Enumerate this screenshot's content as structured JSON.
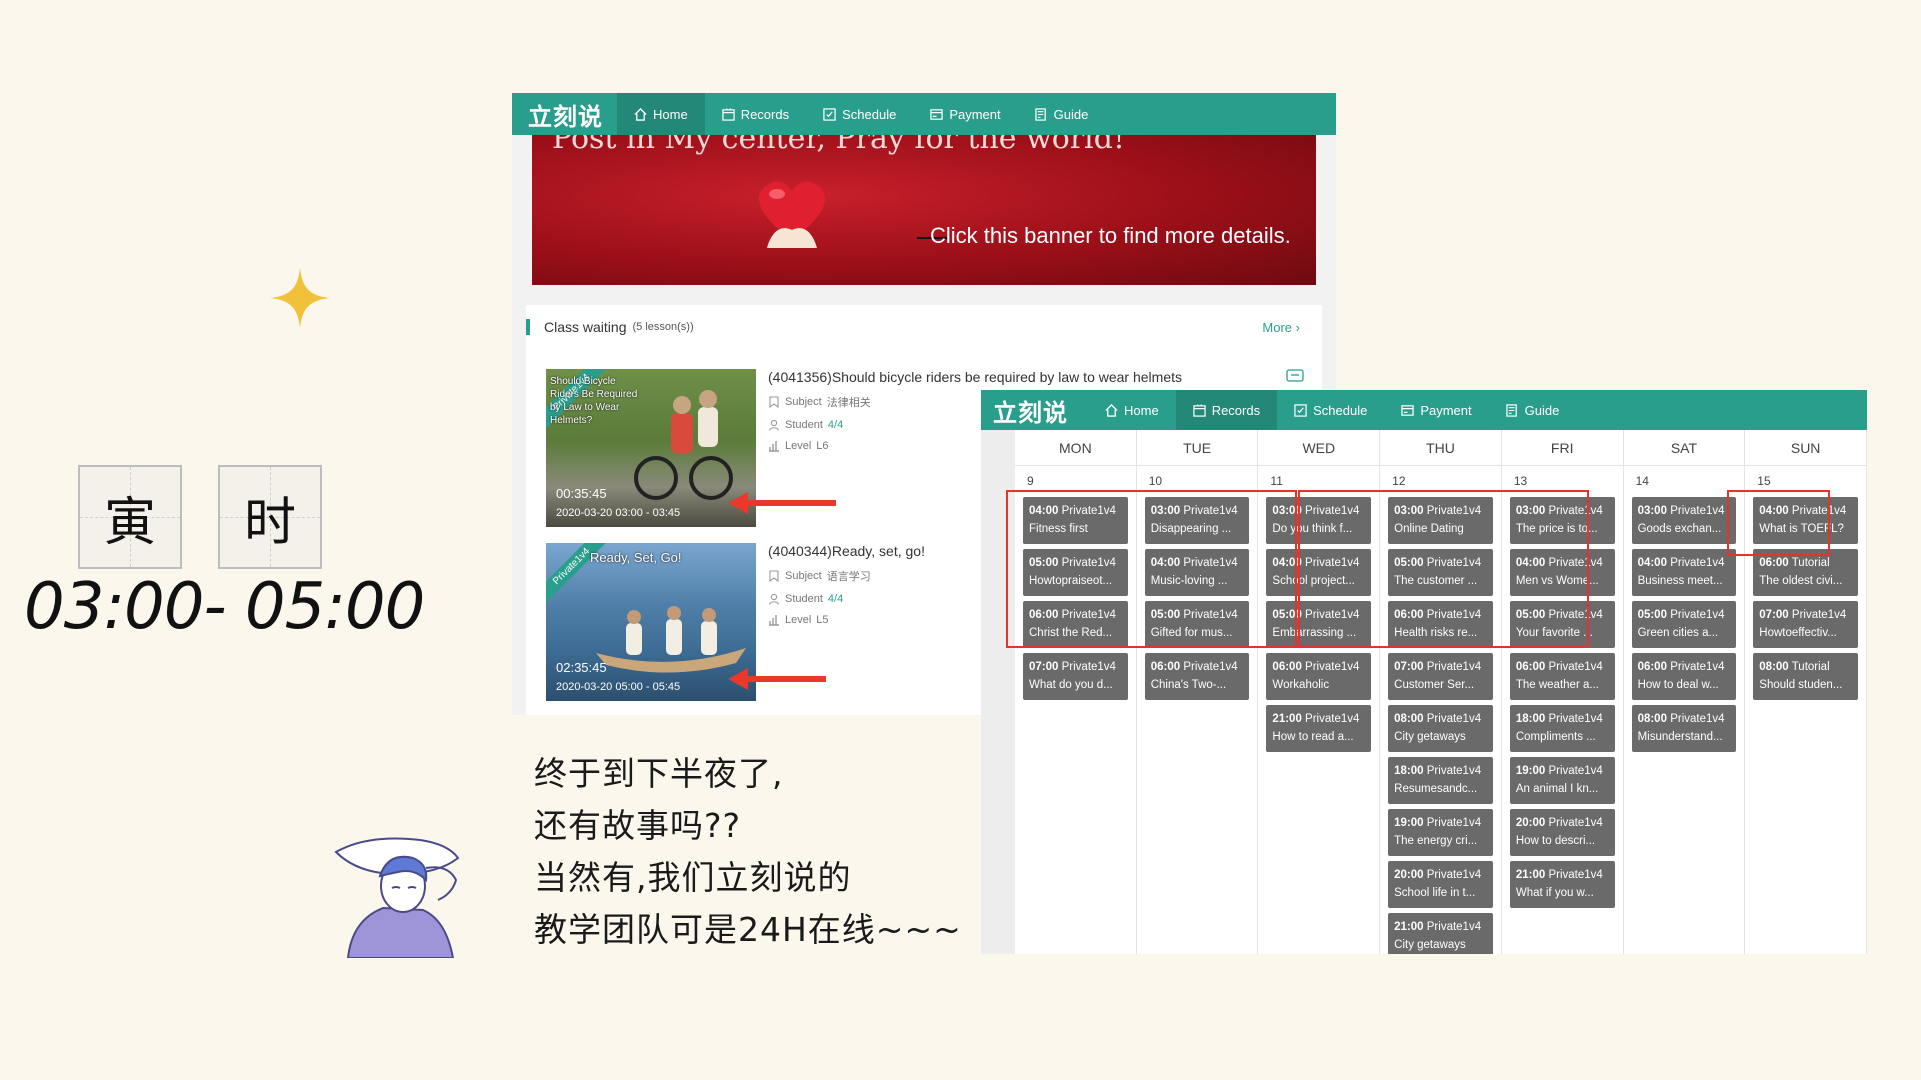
{
  "badge": {
    "chars": [
      "寅",
      "时"
    ],
    "time_range": "03:00- 05:00"
  },
  "caption": {
    "lines": [
      "终于到下半夜了,",
      "还有故事吗??",
      "当然有,我们立刻说的",
      "教学团队可是24H在线~~~"
    ]
  },
  "colors": {
    "brand": "#2a9e8c",
    "highlight": "#e5322b",
    "event_bg": "#6a6a6a"
  },
  "nav1": {
    "logo": "立刻说",
    "items": [
      {
        "label": "Home",
        "icon": "home-icon"
      },
      {
        "label": "Records",
        "icon": "records-icon"
      },
      {
        "label": "Schedule",
        "icon": "schedule-icon"
      },
      {
        "label": "Payment",
        "icon": "payment-icon"
      },
      {
        "label": "Guide",
        "icon": "guide-icon"
      }
    ]
  },
  "banner": {
    "slogan": "Post in My center, Pray for the world!",
    "cta": "Click this banner to find more details."
  },
  "class_waiting": {
    "title": "Class waiting",
    "count": "(5 lesson(s))",
    "more": "More",
    "lessons": [
      {
        "title": "(4041356)Should bicycle riders be required by law to wear helmets",
        "thumb_text": "Should Bicycle Riders Be Required by Law to Wear Helmets?",
        "ribbon": "Private1v4",
        "duration": "00:35:45",
        "date": "2020-03-20 03:00 - 03:45",
        "subject_label": "Subject",
        "subject": "法律相关",
        "student_label": "Student",
        "student": "4/4",
        "level_label": "Level",
        "level": "L6"
      },
      {
        "title": "(4040344)Ready, set, go!",
        "thumb_text": "Ready, Set, Go!",
        "ribbon": "Private1v4",
        "duration": "02:35:45",
        "date": "2020-03-20 05:00 - 05:45",
        "subject_label": "Subject",
        "subject": "语言学习",
        "student_label": "Student",
        "student": "4/4",
        "level_label": "Level",
        "level": "L5"
      }
    ]
  },
  "nav2": {
    "logo": "立刻说",
    "items": [
      {
        "label": "Home",
        "icon": "home-icon"
      },
      {
        "label": "Records",
        "icon": "records-icon"
      },
      {
        "label": "Schedule",
        "icon": "schedule-icon"
      },
      {
        "label": "Payment",
        "icon": "payment-icon"
      },
      {
        "label": "Guide",
        "icon": "guide-icon"
      }
    ]
  },
  "calendar": {
    "days": [
      {
        "name": "MON",
        "num": "9",
        "events": [
          {
            "time": "04:00",
            "type": "Private1v4",
            "title": "Fitness first"
          },
          {
            "time": "05:00",
            "type": "Private1v4",
            "title": "Howtopraiseot..."
          },
          {
            "time": "06:00",
            "type": "Private1v4",
            "title": "Christ the Red..."
          },
          {
            "time": "07:00",
            "type": "Private1v4",
            "title": "What do you d..."
          }
        ]
      },
      {
        "name": "TUE",
        "num": "10",
        "events": [
          {
            "time": "03:00",
            "type": "Private1v4",
            "title": "Disappearing ..."
          },
          {
            "time": "04:00",
            "type": "Private1v4",
            "title": "Music-loving ..."
          },
          {
            "time": "05:00",
            "type": "Private1v4",
            "title": "Gifted for mus..."
          },
          {
            "time": "06:00",
            "type": "Private1v4",
            "title": "China's Two-..."
          }
        ]
      },
      {
        "name": "WED",
        "num": "11",
        "events": [
          {
            "time": "03:00",
            "type": "Private1v4",
            "title": "Do you think f..."
          },
          {
            "time": "04:00",
            "type": "Private1v4",
            "title": "School project..."
          },
          {
            "time": "05:00",
            "type": "Private1v4",
            "title": "Embarrassing ..."
          },
          {
            "time": "06:00",
            "type": "Private1v4",
            "title": "Workaholic"
          },
          {
            "time": "21:00",
            "type": "Private1v4",
            "title": "How to read a..."
          }
        ]
      },
      {
        "name": "THU",
        "num": "12",
        "events": [
          {
            "time": "03:00",
            "type": "Private1v4",
            "title": "Online Dating"
          },
          {
            "time": "05:00",
            "type": "Private1v4",
            "title": "The customer ..."
          },
          {
            "time": "06:00",
            "type": "Private1v4",
            "title": "Health risks re..."
          },
          {
            "time": "07:00",
            "type": "Private1v4",
            "title": "Customer Ser..."
          },
          {
            "time": "08:00",
            "type": "Private1v4",
            "title": "City getaways"
          },
          {
            "time": "18:00",
            "type": "Private1v4",
            "title": "Resumesandc..."
          },
          {
            "time": "19:00",
            "type": "Private1v4",
            "title": "The energy cri..."
          },
          {
            "time": "20:00",
            "type": "Private1v4",
            "title": "School life in t..."
          },
          {
            "time": "21:00",
            "type": "Private1v4",
            "title": "City getaways"
          }
        ]
      },
      {
        "name": "FRI",
        "num": "13",
        "events": [
          {
            "time": "03:00",
            "type": "Private1v4",
            "title": "The price is to..."
          },
          {
            "time": "04:00",
            "type": "Private1v4",
            "title": "Men vs Wome..."
          },
          {
            "time": "05:00",
            "type": "Private1v4",
            "title": "Your favorite ..."
          },
          {
            "time": "06:00",
            "type": "Private1v4",
            "title": "The weather a..."
          },
          {
            "time": "18:00",
            "type": "Private1v4",
            "title": "Compliments ..."
          },
          {
            "time": "19:00",
            "type": "Private1v4",
            "title": "An animal I kn..."
          },
          {
            "time": "20:00",
            "type": "Private1v4",
            "title": "How to descri..."
          },
          {
            "time": "21:00",
            "type": "Private1v4",
            "title": "What if you w..."
          }
        ]
      },
      {
        "name": "SAT",
        "num": "14",
        "events": [
          {
            "time": "03:00",
            "type": "Private1v4",
            "title": "Goods exchan..."
          },
          {
            "time": "04:00",
            "type": "Private1v4",
            "title": "Business meet..."
          },
          {
            "time": "05:00",
            "type": "Private1v4",
            "title": "Green cities a..."
          },
          {
            "time": "06:00",
            "type": "Private1v4",
            "title": "How to deal w..."
          },
          {
            "time": "08:00",
            "type": "Private1v4",
            "title": "Misunderstand..."
          }
        ]
      },
      {
        "name": "SUN",
        "num": "15",
        "events": [
          {
            "time": "04:00",
            "type": "Private1v4",
            "title": "What is TOEFL?"
          },
          {
            "time": "06:00",
            "type": "Tutorial",
            "title": "The oldest civi..."
          },
          {
            "time": "07:00",
            "type": "Private1v4",
            "title": "Howtoeffectiv..."
          },
          {
            "time": "08:00",
            "type": "Tutorial",
            "title": "Should studen..."
          }
        ]
      }
    ]
  }
}
